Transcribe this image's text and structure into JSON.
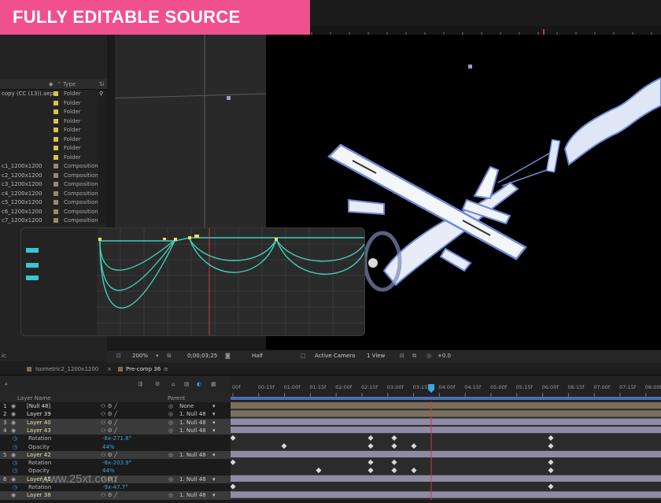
{
  "banner": {
    "text": "FULLY EDITABLE SOURCE FILE(.AEP)"
  },
  "project": {
    "type_header": "Type",
    "size_header": "Si",
    "rows": [
      {
        "name": "copy (CC (13)).aep",
        "type": "Folder",
        "color": "#d9c445"
      },
      {
        "name": "",
        "type": "Folder",
        "color": "#d9c445"
      },
      {
        "name": "",
        "type": "Folder",
        "color": "#d9c445"
      },
      {
        "name": "",
        "type": "Folder",
        "color": "#d9c445"
      },
      {
        "name": "",
        "type": "Folder",
        "color": "#d9c445"
      },
      {
        "name": "",
        "type": "Folder",
        "color": "#d9c445"
      },
      {
        "name": "",
        "type": "Folder",
        "color": "#d9c445"
      },
      {
        "name": "",
        "type": "Folder",
        "color": "#d9c445"
      },
      {
        "name": "c1_1200x1200",
        "type": "Composition",
        "color": "#9a8a6a"
      },
      {
        "name": "c2_1200x1200",
        "type": "Composition",
        "color": "#9a8a6a"
      },
      {
        "name": "c3_1200x1200",
        "type": "Composition",
        "color": "#9a8a6a"
      },
      {
        "name": "c4_1200x1200",
        "type": "Composition",
        "color": "#9a8a6a"
      },
      {
        "name": "c5_1200x1200",
        "type": "Composition",
        "color": "#9a8a6a"
      },
      {
        "name": "c6_1200x1200",
        "type": "Composition",
        "color": "#9a8a6a"
      },
      {
        "name": "c7_1200x1200",
        "type": "Composition",
        "color": "#9a8a6a"
      }
    ]
  },
  "viewer": {
    "zoom": "200%",
    "timecode": "0;00;03;25",
    "resolution": "Half",
    "camera": "Active Camera",
    "views": "1 View",
    "exposure": "+0.0",
    "bottom_left_label": "ic"
  },
  "tabs": [
    {
      "label": "Isometric2_1200x1200"
    },
    {
      "label": "Pre-comp 36"
    }
  ],
  "timeline": {
    "search_placeholder": "",
    "col_layer_name": "Layer Name",
    "col_parent": "Parent",
    "time_labels": [
      "00f",
      "00:15f",
      "01:00f",
      "01:15f",
      "02:00f",
      "02:15f",
      "03:00f",
      "03:15f",
      "04:00f",
      "04:15f",
      "05:00f",
      "05:15f",
      "06:00f",
      "06:15f",
      "07:00f",
      "07:15f",
      "08:00f"
    ],
    "layers": [
      {
        "num": "1",
        "name": "[Null 48]",
        "parent": "None",
        "kind": "layer",
        "highlight": false,
        "bar": "#7a6e5a"
      },
      {
        "num": "2",
        "name": "Layer 39",
        "parent": "1. Null 48",
        "kind": "layer",
        "highlight": false,
        "bar": "#7a7060"
      },
      {
        "num": "3",
        "name": "Layer 40",
        "parent": "1. Null 48",
        "kind": "layer",
        "highlight": true,
        "bar": "#8f8aa6"
      },
      {
        "num": "4",
        "name": "Layer 43",
        "parent": "1. Null 48",
        "kind": "layer",
        "highlight": true,
        "bar": "#8f8aa6"
      },
      {
        "num": "",
        "name": "Rotation",
        "parent": "",
        "kind": "prop",
        "value": "-8x-271.8°",
        "highlight": false
      },
      {
        "num": "",
        "name": "Opacity",
        "parent": "",
        "kind": "prop",
        "value": "44%",
        "highlight": false
      },
      {
        "num": "5",
        "name": "Layer 42",
        "parent": "1. Null 48",
        "kind": "layer",
        "highlight": true,
        "bar": "#8f8aa6"
      },
      {
        "num": "",
        "name": "Rotation",
        "parent": "",
        "kind": "prop",
        "value": "-8x-203.9°",
        "highlight": false
      },
      {
        "num": "",
        "name": "Opacity",
        "parent": "",
        "kind": "prop",
        "value": "44%",
        "highlight": false
      },
      {
        "num": "6",
        "name": "Layer 41",
        "parent": "1. Null 48",
        "kind": "layer",
        "highlight": true,
        "bar": "#8f8aa6"
      },
      {
        "num": "",
        "name": "Rotation",
        "parent": "",
        "kind": "prop",
        "value": "-9x-47.7°",
        "highlight": false
      },
      {
        "num": "",
        "name": "Layer 38",
        "parent": "1. Null 48",
        "kind": "layer",
        "highlight": true,
        "bar": "#8f8aa6"
      }
    ],
    "watermark": "www.25xt.com"
  },
  "colors": {
    "accent": "#f0508d",
    "graph_curve": "#3fcfb8",
    "graph_key": "#e9e05a",
    "playhead": "#d13a3a",
    "airplane_fill": "#f2f5fa",
    "airplane_edge": "#6f8ad6"
  }
}
